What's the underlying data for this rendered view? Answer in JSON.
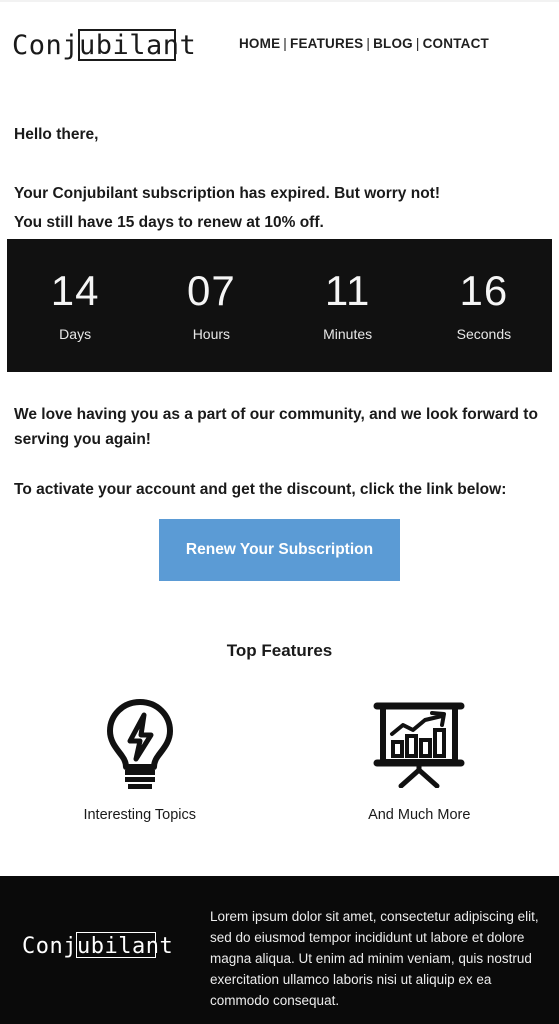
{
  "header": {
    "logo_text": "Conjubilant",
    "nav_items": [
      "HOME",
      "FEATURES",
      "BLOG",
      "CONTACT"
    ],
    "nav_separator": "|"
  },
  "intro": {
    "greeting": "Hello there,",
    "line1": "Your Conjubilant subscription has expired. But worry not!",
    "line2": "You still have 15 days to renew at 10% off."
  },
  "countdown": {
    "background_color": "#111111",
    "units": [
      {
        "value": "14",
        "label": "Days"
      },
      {
        "value": "07",
        "label": "Hours"
      },
      {
        "value": "11",
        "label": "Minutes"
      },
      {
        "value": "16",
        "label": "Seconds"
      }
    ]
  },
  "mid": {
    "paragraph1": "We love having you as a part of our community, and we look forward to serving you again!",
    "paragraph2": "To activate your account and get the discount, click the link below:"
  },
  "cta": {
    "label": "Renew Your Subscription",
    "background_color": "#5b9bd5",
    "text_color": "#ffffff"
  },
  "features": {
    "title": "Top Features",
    "items": [
      {
        "icon": "lightbulb-icon",
        "label": "Interesting Topics"
      },
      {
        "icon": "presentation-chart-icon",
        "label": "And Much More"
      }
    ]
  },
  "footer": {
    "background_color": "#0a0a0a",
    "logo_text": "Conjubilant",
    "copy": "Lorem ipsum dolor sit amet, consectetur adipiscing elit, sed do eiusmod tempor incididunt ut labore et dolore magna aliqua. Ut enim ad minim veniam, quis nostrud exercitation ullamco laboris nisi ut aliquip ex ea commodo consequat."
  }
}
